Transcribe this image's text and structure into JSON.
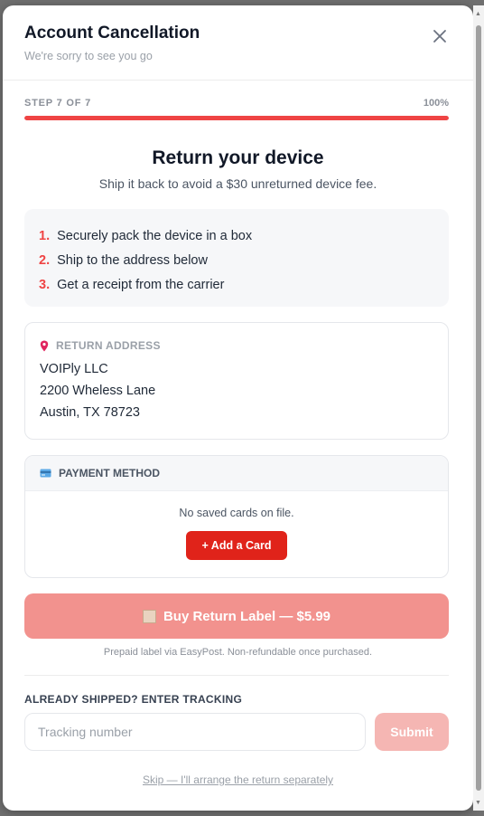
{
  "header": {
    "title": "Account Cancellation",
    "subtitle": "We're sorry to see you go"
  },
  "progress": {
    "step_label": "STEP 7 OF 7",
    "percent_label": "100%",
    "value": 1.0,
    "color": "#ef4444"
  },
  "main": {
    "heading": "Return your device",
    "lead": "Ship it back to avoid a $30 unreturned device fee.",
    "steps": [
      {
        "num": "1.",
        "text": "Securely pack the device in a box"
      },
      {
        "num": "2.",
        "text": "Ship to the address below"
      },
      {
        "num": "3.",
        "text": "Get a receipt from the carrier"
      }
    ]
  },
  "return_address": {
    "icon": "map-pin-icon",
    "label": "RETURN ADDRESS",
    "lines": [
      "VOIPly LLC",
      "2200 Wheless Lane",
      "Austin, TX 78723"
    ]
  },
  "payment": {
    "icon": "credit-card-icon",
    "label": "PAYMENT METHOD",
    "empty_text": "No saved cards on file.",
    "add_card_label": "+ Add a Card"
  },
  "buy": {
    "icon": "package-icon",
    "label": "Buy Return Label — $5.99",
    "note": "Prepaid label via EasyPost. Non-refundable once purchased."
  },
  "tracking": {
    "heading": "ALREADY SHIPPED? ENTER TRACKING",
    "placeholder": "Tracking number",
    "value": "",
    "submit_label": "Submit"
  },
  "skip_link": "Skip — I'll arrange the return separately",
  "colors": {
    "accent": "#e0231a",
    "buy_disabled": "#f2928e",
    "submit_disabled": "#f5b6b3"
  }
}
